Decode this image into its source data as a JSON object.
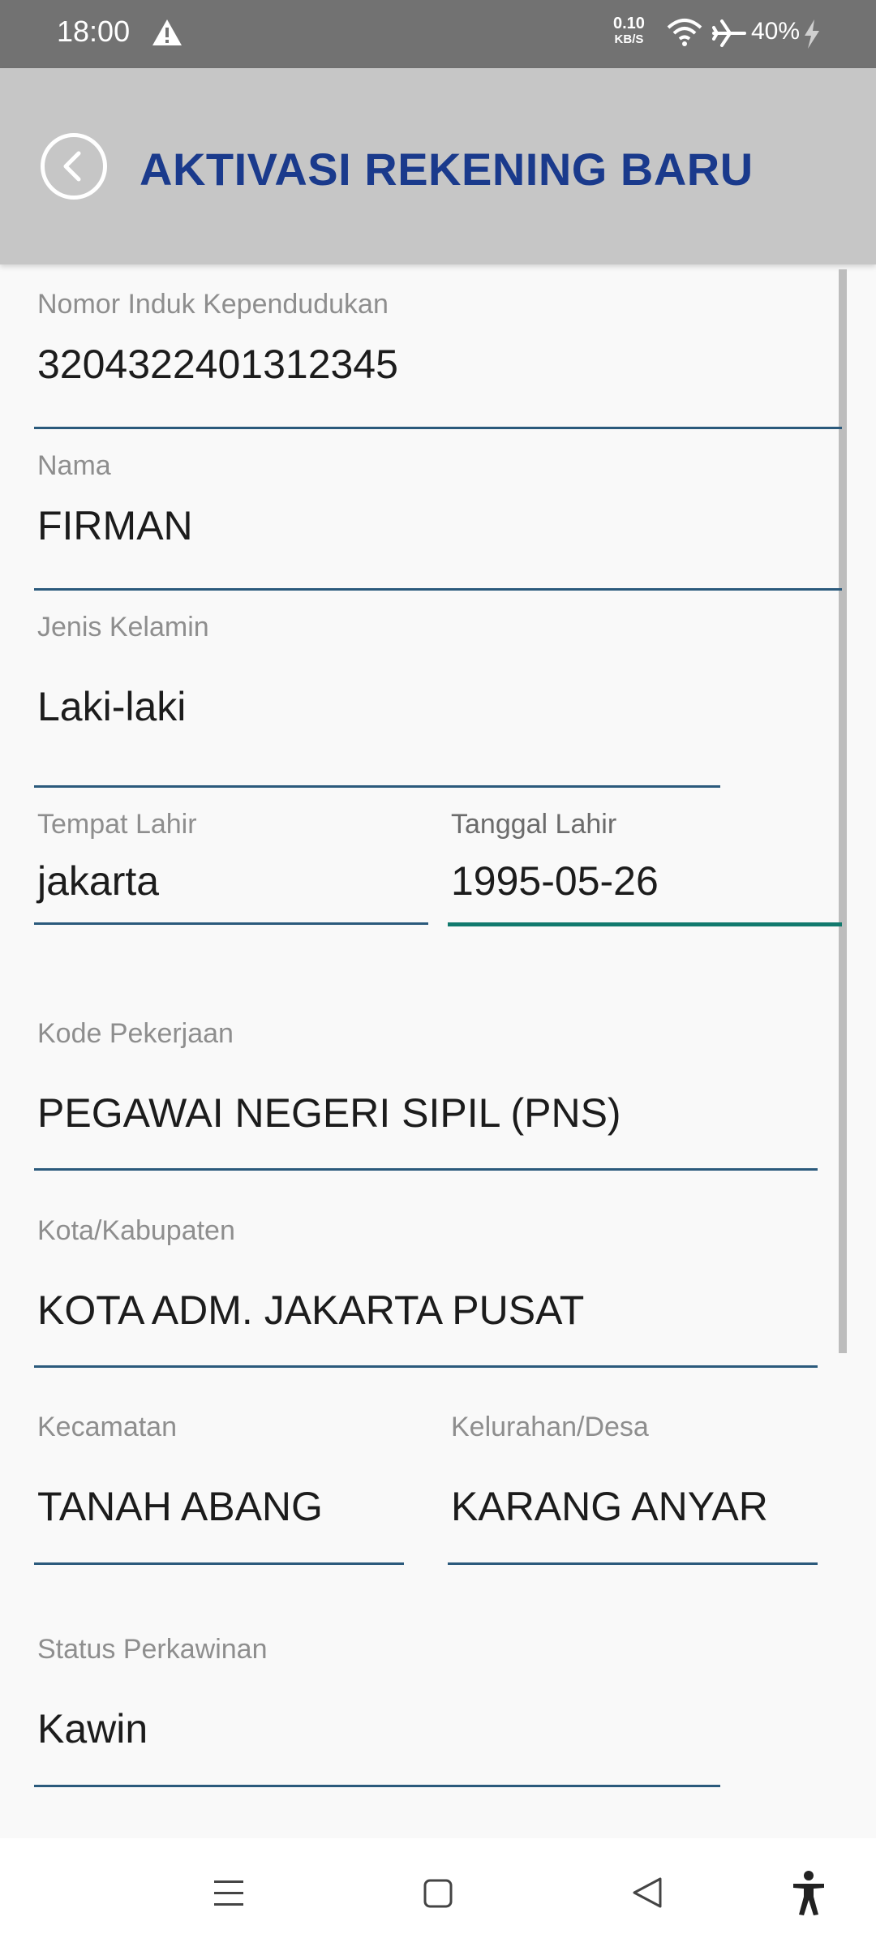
{
  "status_bar": {
    "time": "18:00",
    "network_speed_value": "0.10",
    "network_speed_unit": "KB/S",
    "battery": "40%",
    "icons": [
      "warning-icon",
      "wifi-icon",
      "airplane-icon",
      "charging-icon"
    ]
  },
  "header": {
    "title": "AKTIVASI REKENING BARU",
    "back_icon": "chevron-left-icon"
  },
  "form": {
    "nik": {
      "label": "Nomor Induk Kependudukan",
      "value": "3204322401312345"
    },
    "nama": {
      "label": "Nama",
      "value": "FIRMAN"
    },
    "jenis_kelamin": {
      "label": "Jenis Kelamin",
      "value": "Laki-laki"
    },
    "tempat_lahir": {
      "label": "Tempat Lahir",
      "value": "jakarta"
    },
    "tanggal_lahir": {
      "label": "Tanggal Lahir",
      "value": "1995-05-26"
    },
    "kode_pekerjaan": {
      "label": "Kode Pekerjaan",
      "value": "PEGAWAI NEGERI SIPIL (PNS)"
    },
    "kota": {
      "label": "Kota/Kabupaten",
      "value": "KOTA ADM. JAKARTA PUSAT"
    },
    "kecamatan": {
      "label": "Kecamatan",
      "value": "TANAH ABANG"
    },
    "kelurahan": {
      "label": "Kelurahan/Desa",
      "value": "KARANG ANYAR"
    },
    "status_perkawinan": {
      "label": "Status Perkawinan",
      "value": "Kawin"
    }
  },
  "colors": {
    "header_bg": "#c6c6c6",
    "title": "#1a3a8c",
    "underline": "#2b5a7c",
    "underline_active": "#127a6e"
  },
  "nav_bar": {
    "icons": [
      "menu-icon",
      "home-square-icon",
      "back-triangle-icon",
      "accessibility-icon"
    ]
  }
}
